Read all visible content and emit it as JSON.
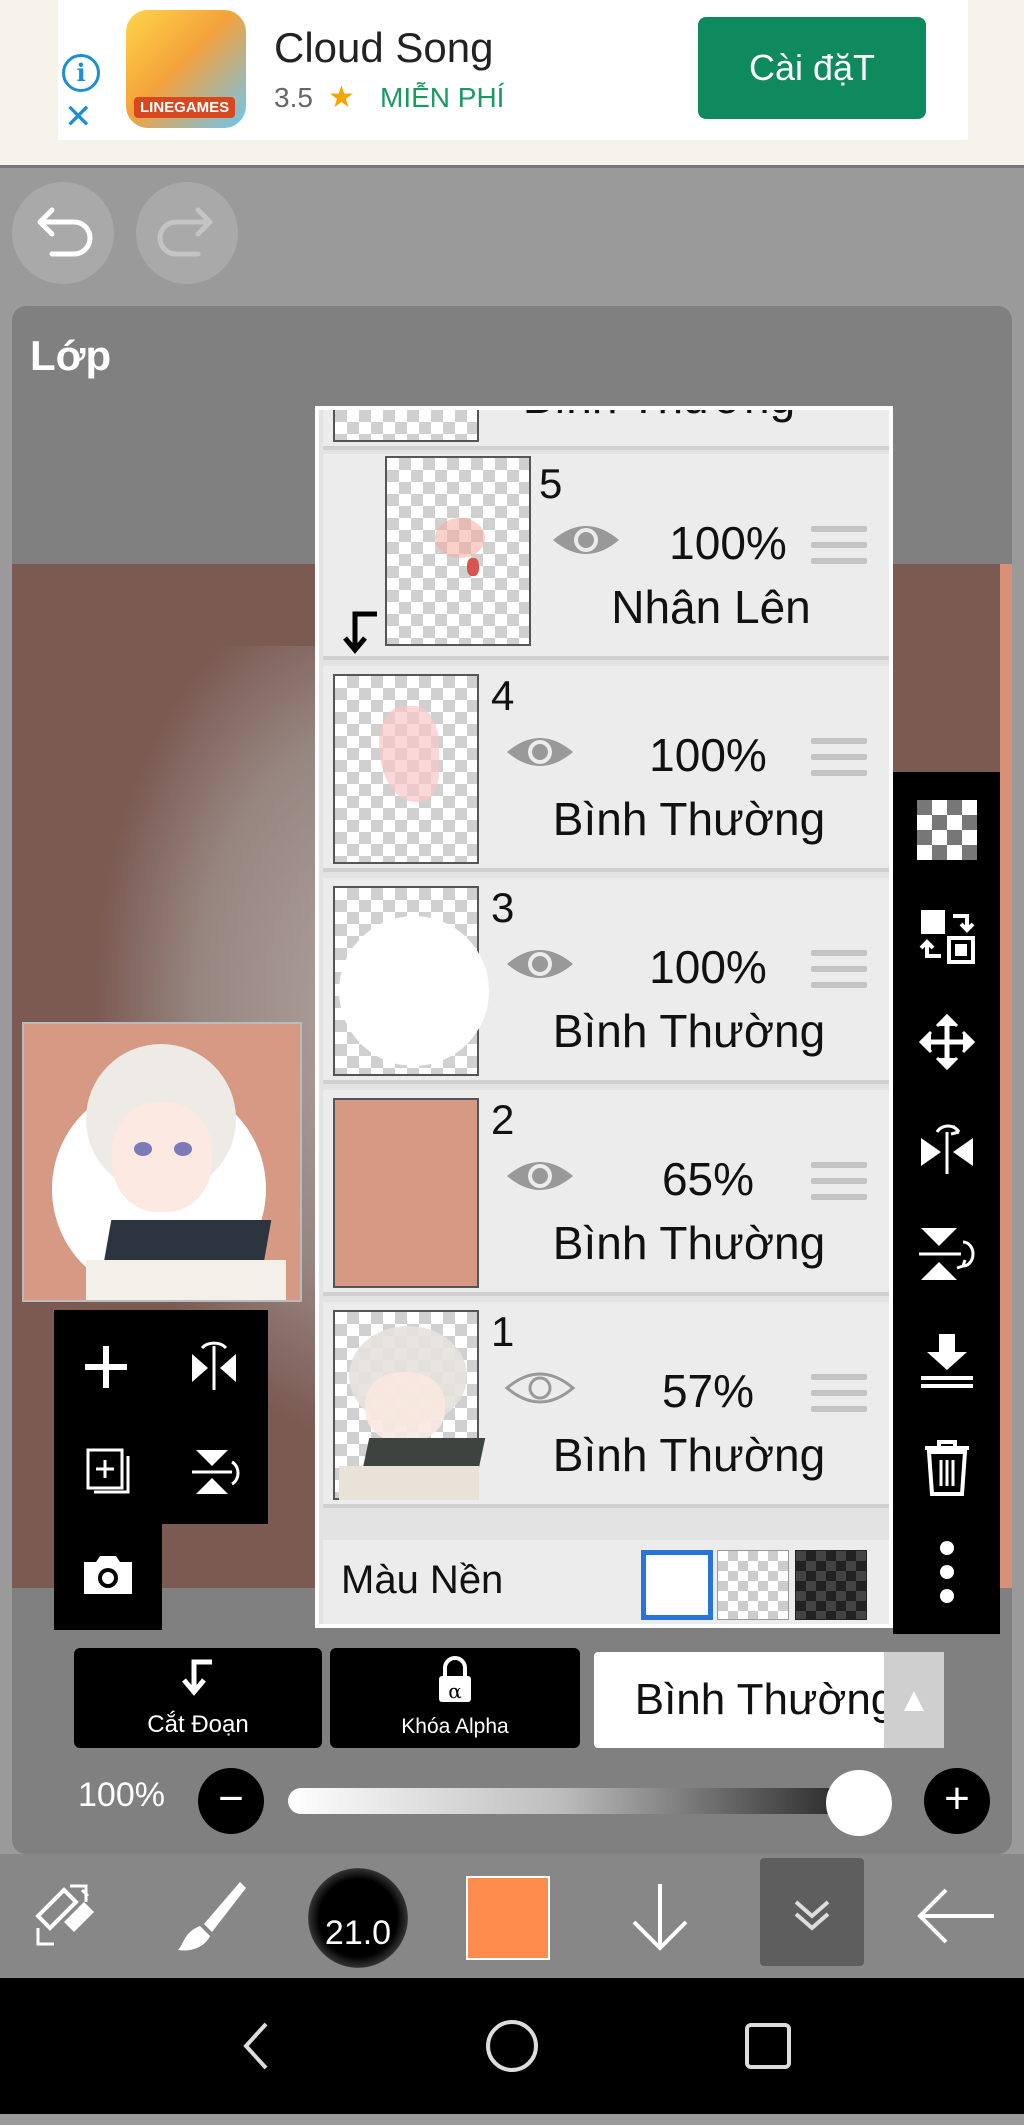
{
  "ad": {
    "app_name": "Cloud Song",
    "rating": "3.5",
    "price": "MIỄN PHÍ",
    "install_label": "Cài đặT",
    "brand": "LINEGAMES",
    "info_icon": "info-icon",
    "close_icon": "close-icon"
  },
  "panel": {
    "title": "Lớp"
  },
  "layers": [
    {
      "num": "5",
      "opacity": "100%",
      "mode": "Nhân Lên",
      "visible": true
    },
    {
      "num": "4",
      "opacity": "100%",
      "mode": "Bình Thường",
      "visible": true
    },
    {
      "num": "3",
      "opacity": "100%",
      "mode": "Bình Thường",
      "visible": true
    },
    {
      "num": "2",
      "opacity": "65%",
      "mode": "Bình Thường",
      "visible": true
    },
    {
      "num": "1",
      "opacity": "57%",
      "mode": "Bình Thường",
      "visible": false
    }
  ],
  "partial_layer_mode": "Bình Thường",
  "background": {
    "label": "Màu Nền"
  },
  "bottom_panel": {
    "clip_label": "Cắt Đoạn",
    "alpha_lock_label": "Khóa Alpha",
    "blend_mode": "Bình Thường",
    "opacity_label": "100%",
    "opacity_value": 1.0
  },
  "toolbar": {
    "brush_size": "21.0",
    "color": "#ff8c4c"
  },
  "colors": {
    "install_button": "#0f8a5f",
    "accent_blue": "#2874d8",
    "canvas": "#7b5a52"
  }
}
